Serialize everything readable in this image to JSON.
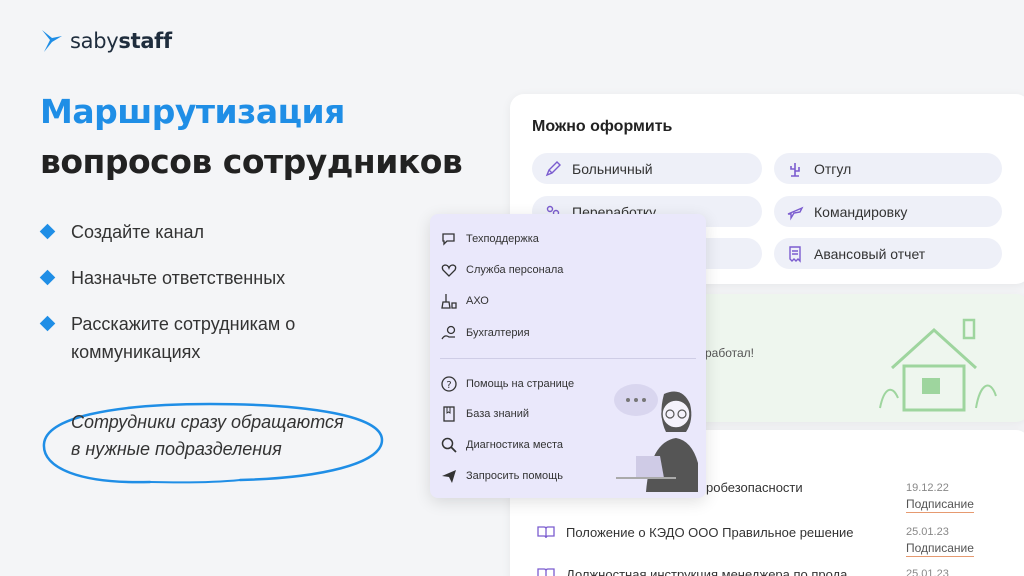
{
  "brand": {
    "name_prefix": "saby",
    "name_suffix": "staff"
  },
  "hero": {
    "title_line1": "Маршрутизация",
    "title_line2": "вопросов сотрудников"
  },
  "bullets": [
    "Создайте канал",
    "Назначьте ответственных",
    "Расскажите сотрудникам о коммуникациях"
  ],
  "callout": {
    "line1": "Сотрудники сразу обращаются",
    "line2": "в нужные подразделения"
  },
  "request_card": {
    "title": "Можно оформить",
    "items": [
      {
        "label": "Больничный",
        "icon": "pen-icon"
      },
      {
        "label": "Отгул",
        "icon": "cactus-icon"
      },
      {
        "label": "Переработку",
        "icon": "people-icon"
      },
      {
        "label": "Командировку",
        "icon": "plane-icon"
      },
      {
        "label": "Авансовый отчет",
        "icon": "receipt-icon"
      }
    ]
  },
  "green_card": {
    "text": "работал!"
  },
  "docs": {
    "rows": [
      {
        "title": "робезопасности",
        "date": "19.12.22",
        "status": "Подписание"
      },
      {
        "title": "Положение о КЭДО ООО Правильное решение",
        "date": "25.01.23",
        "status": "Подписание"
      },
      {
        "title": "Должностная инструкция менеджера по прода",
        "date": "25.01.23",
        "status": ""
      }
    ]
  },
  "menu": {
    "channels": [
      {
        "label": "Техподдержка",
        "icon": "chat-icon"
      },
      {
        "label": "Служба персонала",
        "icon": "heart-icon"
      },
      {
        "label": "АХО",
        "icon": "broom-icon"
      },
      {
        "label": "Бухгалтерия",
        "icon": "coins-icon"
      }
    ],
    "help": [
      {
        "label": "Помощь на странице",
        "icon": "question-icon"
      },
      {
        "label": "База знаний",
        "icon": "book-icon"
      },
      {
        "label": "Диагностика места",
        "icon": "magnifier-icon"
      },
      {
        "label": "Запросить помощь",
        "icon": "send-icon"
      }
    ]
  },
  "colors": {
    "accent": "#1f8ee6",
    "menu_bg": "#eae8fb",
    "chip_bg": "#eef0f8",
    "icon": "#7b5ccf"
  }
}
